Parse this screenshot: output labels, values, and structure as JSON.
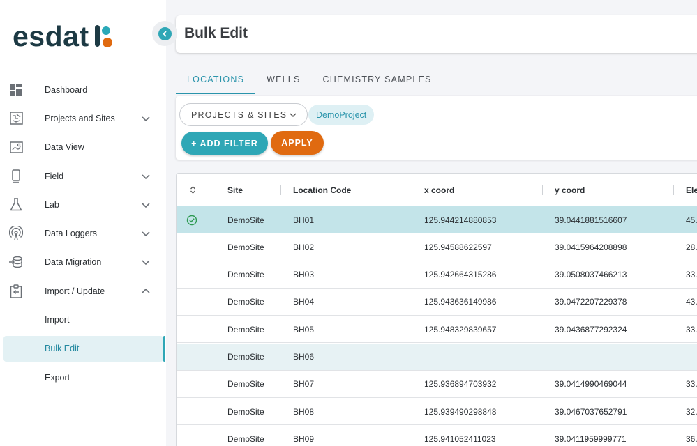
{
  "app": {
    "logo_text": "esdat"
  },
  "header": {
    "title": "Bulk Edit"
  },
  "sidebar": {
    "items": [
      {
        "label": "Dashboard",
        "icon": "dashboard-icon",
        "chevron": ""
      },
      {
        "label": "Projects and Sites",
        "icon": "map-icon",
        "chevron": "down"
      },
      {
        "label": "Data View",
        "icon": "data-view-icon",
        "chevron": ""
      },
      {
        "label": "Field",
        "icon": "mobile-icon",
        "chevron": "down"
      },
      {
        "label": "Lab",
        "icon": "flask-icon",
        "chevron": "down"
      },
      {
        "label": "Data Loggers",
        "icon": "antenna-icon",
        "chevron": "down"
      },
      {
        "label": "Data Migration",
        "icon": "database-import-icon",
        "chevron": "down"
      },
      {
        "label": "Import / Update",
        "icon": "clipboard-import-icon",
        "chevron": "up"
      },
      {
        "label": "Import",
        "icon": "",
        "chevron": ""
      },
      {
        "label": "Bulk Edit",
        "icon": "",
        "chevron": "",
        "active": true
      },
      {
        "label": "Export",
        "icon": "",
        "chevron": ""
      }
    ]
  },
  "tabs": [
    {
      "label": "LOCATIONS",
      "active": true
    },
    {
      "label": "WELLS",
      "active": false
    },
    {
      "label": "CHEMISTRY SAMPLES",
      "active": false
    }
  ],
  "filters": {
    "projects_button": "PROJECTS & SITES",
    "chip": "DemoProject",
    "add_filter": "+ ADD FILTER",
    "apply": "APPLY"
  },
  "colors": {
    "accent": "#2fa7b6",
    "orange": "#e06a10",
    "selected_row": "#c3e4e9"
  },
  "table": {
    "columns": [
      "Site",
      "Location Code",
      "x coord",
      "y coord",
      "Ele"
    ],
    "rows": [
      {
        "site": "DemoSite",
        "code": "BH01",
        "x": "125.944214880853",
        "y": "39.0441881516607",
        "ele": "45.",
        "selected": true
      },
      {
        "site": "DemoSite",
        "code": "BH02",
        "x": "125.94588622597",
        "y": "39.0415964208898",
        "ele": "28."
      },
      {
        "site": "DemoSite",
        "code": "BH03",
        "x": "125.942664315286",
        "y": "39.0508037466213",
        "ele": "33."
      },
      {
        "site": "DemoSite",
        "code": "BH04",
        "x": "125.943636149986",
        "y": "39.0472207229378",
        "ele": "43."
      },
      {
        "site": "DemoSite",
        "code": "BH05",
        "x": "125.948329839657",
        "y": "39.0436877292324",
        "ele": "33."
      },
      {
        "site": "DemoSite",
        "code": "BH06",
        "x": "",
        "y": "",
        "ele": "",
        "alt": true
      },
      {
        "site": "DemoSite",
        "code": "BH07",
        "x": "125.936894703932",
        "y": "39.0414990469044",
        "ele": "33."
      },
      {
        "site": "DemoSite",
        "code": "BH08",
        "x": "125.939490298848",
        "y": "39.0467037652791",
        "ele": "32."
      },
      {
        "site": "DemoSite",
        "code": "BH09",
        "x": "125.941052411023",
        "y": "39.0411959999771",
        "ele": "36."
      }
    ]
  }
}
